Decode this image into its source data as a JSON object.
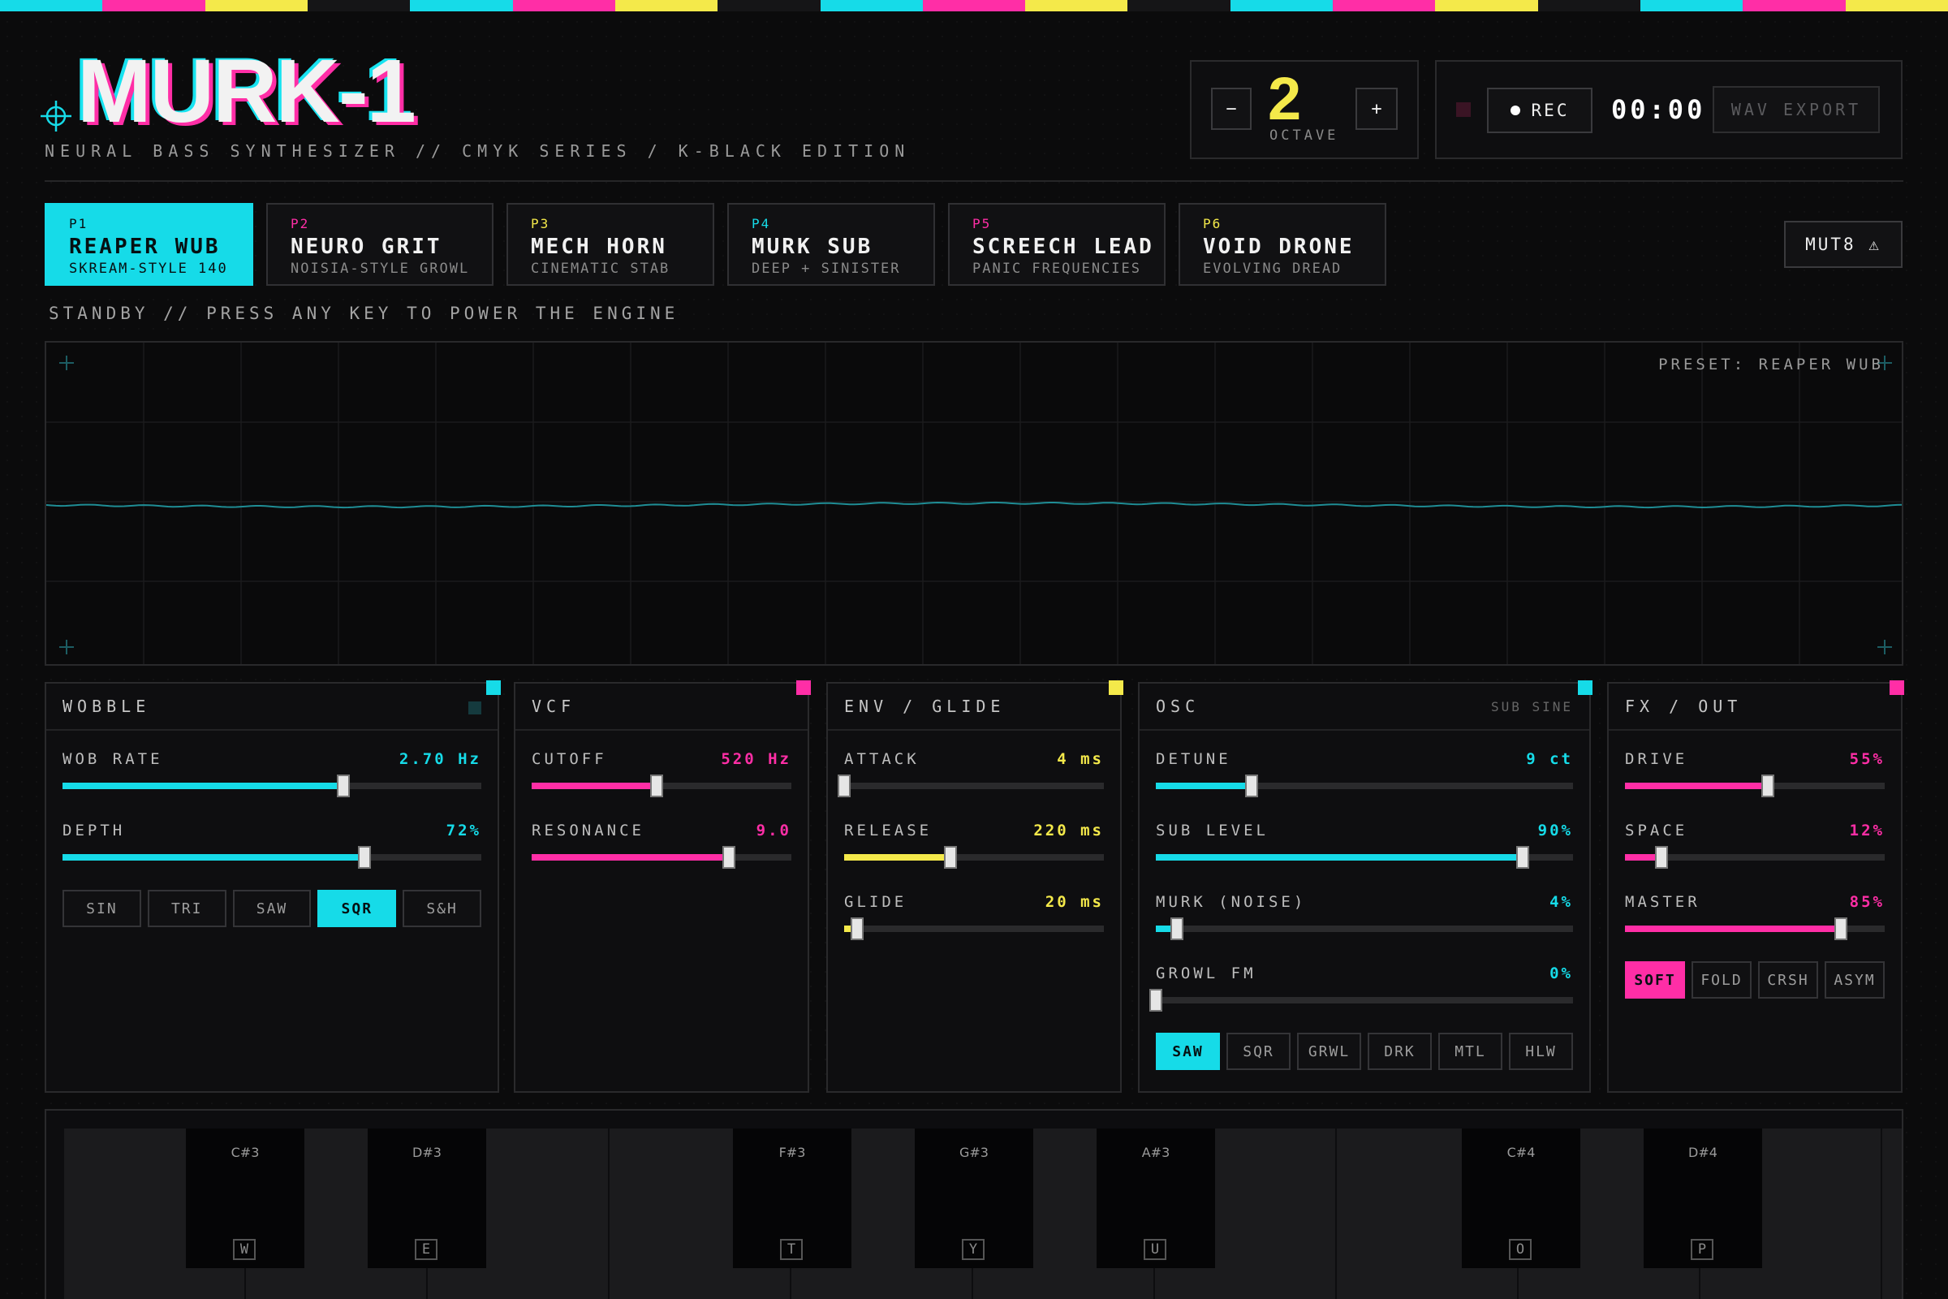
{
  "colors": {
    "cyan": "#16dbe8",
    "magenta": "#ff2ea6",
    "yellow": "#f4e94a",
    "black": "#151517"
  },
  "header": {
    "title": "MURK-1",
    "subtitle": "NEURAL BASS SYNTHESIZER // CMYK SERIES / K-BLACK EDITION"
  },
  "octave": {
    "value": "2",
    "label": "OCTAVE",
    "minus": "−",
    "plus": "+"
  },
  "recorder": {
    "rec_label": "REC",
    "timer": "00:00",
    "export_label": "WAV EXPORT"
  },
  "presets": [
    {
      "id": "P1",
      "name": "REAPER WUB",
      "desc": "SKREAM-STYLE 140",
      "active": true,
      "accent": "#16dbe8"
    },
    {
      "id": "P2",
      "name": "NEURO GRIT",
      "desc": "NOISIA-STYLE GROWL",
      "active": false,
      "accent": "#ff2ea6"
    },
    {
      "id": "P3",
      "name": "MECH HORN",
      "desc": "CINEMATIC STAB",
      "active": false,
      "accent": "#f4e94a"
    },
    {
      "id": "P4",
      "name": "MURK SUB",
      "desc": "DEEP + SINISTER",
      "active": false,
      "accent": "#16dbe8"
    },
    {
      "id": "P5",
      "name": "SCREECH LEAD",
      "desc": "PANIC FREQUENCIES",
      "active": false,
      "accent": "#ff2ea6"
    },
    {
      "id": "P6",
      "name": "VOID DRONE",
      "desc": "EVOLVING DREAD",
      "active": false,
      "accent": "#f4e94a"
    }
  ],
  "mutate_label": "MUT8 ⚠",
  "status": "STANDBY // PRESS ANY KEY TO POWER THE ENGINE",
  "scope": {
    "preset_label": "PRESET: REAPER WUB"
  },
  "panels": {
    "wobble": {
      "title": "WOBBLE",
      "controls": [
        {
          "label": "WOB RATE",
          "value": "2.70 Hz",
          "level": 0.67
        },
        {
          "label": "DEPTH",
          "value": "72%",
          "level": 0.72
        }
      ],
      "shapes": [
        "SIN",
        "TRI",
        "SAW",
        "SQR",
        "S&H"
      ],
      "active_shape": "SQR"
    },
    "vcf": {
      "title": "VCF",
      "controls": [
        {
          "label": "CUTOFF",
          "value": "520 Hz",
          "level": 0.48
        },
        {
          "label": "RESONANCE",
          "value": "9.0",
          "level": 0.76
        }
      ]
    },
    "env": {
      "title": "ENV / GLIDE",
      "controls": [
        {
          "label": "ATTACK",
          "value": "4 ms",
          "level": 0.0
        },
        {
          "label": "RELEASE",
          "value": "220 ms",
          "level": 0.41
        },
        {
          "label": "GLIDE",
          "value": "20 ms",
          "level": 0.05
        }
      ]
    },
    "osc": {
      "title": "OSC",
      "sub_mode": "SUB SINE",
      "controls": [
        {
          "label": "DETUNE",
          "value": "9 ct",
          "level": 0.23
        },
        {
          "label": "SUB LEVEL",
          "value": "90%",
          "level": 0.88
        },
        {
          "label": "MURK (NOISE)",
          "value": "4%",
          "level": 0.05
        },
        {
          "label": "GROWL FM",
          "value": "0%",
          "level": 0.0
        }
      ],
      "shapes": [
        "SAW",
        "SQR",
        "GRWL",
        "DRK",
        "MTL",
        "HLW"
      ],
      "active_shape": "SAW"
    },
    "fx": {
      "title": "FX / OUT",
      "controls": [
        {
          "label": "DRIVE",
          "value": "55%",
          "level": 0.55
        },
        {
          "label": "SPACE",
          "value": "12%",
          "level": 0.14
        },
        {
          "label": "MASTER",
          "value": "85%",
          "level": 0.83
        }
      ],
      "modes": [
        "SOFT",
        "FOLD",
        "CRSH",
        "ASYM"
      ],
      "active_mode": "SOFT"
    }
  },
  "keyboard": {
    "black_keys": [
      {
        "note": "C#3",
        "key": "W"
      },
      {
        "note": "D#3",
        "key": "E"
      },
      {
        "note": "F#3",
        "key": "T"
      },
      {
        "note": "G#3",
        "key": "Y"
      },
      {
        "note": "A#3",
        "key": "U"
      },
      {
        "note": "C#4",
        "key": "O"
      },
      {
        "note": "D#4",
        "key": "P"
      }
    ]
  }
}
